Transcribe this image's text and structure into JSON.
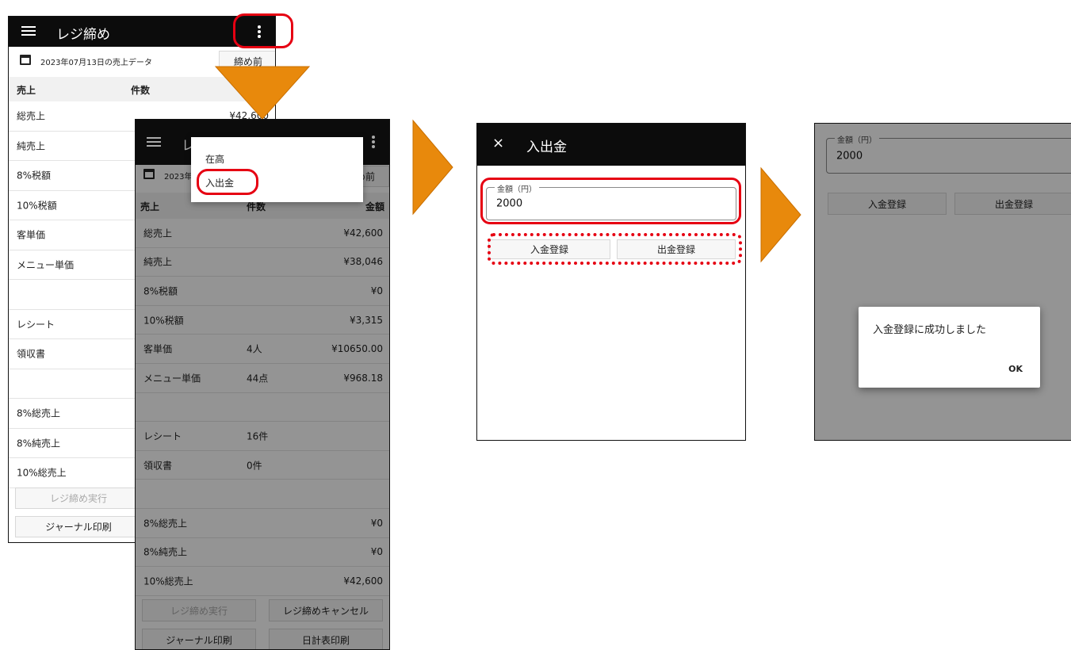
{
  "colors": {
    "appbar": "#0c0c0c",
    "highlight": "#e60012",
    "arrow": "#e8890c"
  },
  "screen1": {
    "menu_icon": "hamburger-icon",
    "title": "レジ締め",
    "overflow_icon": "more-vert-icon",
    "date_text": "2023年07月13日の売上データ",
    "status_button": "締め前",
    "header": {
      "col1": "売上",
      "col2": "件数"
    },
    "rows": [
      {
        "label": "総売上",
        "count": "",
        "amount": "¥42,600"
      },
      {
        "label": "純売上",
        "count": "",
        "amount": ""
      },
      {
        "label": "8%税額",
        "count": "",
        "amount": ""
      },
      {
        "label": "10%税額",
        "count": "",
        "amount": ""
      },
      {
        "label": "客単価",
        "count": "",
        "amount": ""
      },
      {
        "label": "メニュー単価",
        "count": "",
        "amount": ""
      },
      {
        "label": "",
        "count": "",
        "amount": ""
      },
      {
        "label": "レシート",
        "count": "",
        "amount": ""
      },
      {
        "label": "領収書",
        "count": "",
        "amount": ""
      },
      {
        "label": "",
        "count": "",
        "amount": ""
      },
      {
        "label": "8%総売上",
        "count": "",
        "amount": ""
      },
      {
        "label": "8%純売上",
        "count": "",
        "amount": ""
      },
      {
        "label": "10%総売上",
        "count": "",
        "amount": ""
      }
    ],
    "execute_button": "レジ締め実行",
    "journal_button": "ジャーナル印刷"
  },
  "screen2": {
    "title": "レジ締め",
    "date_text": "2023年",
    "status_button": "締め前",
    "header": {
      "col1": "売上",
      "col2": "件数",
      "col3": "金額"
    },
    "rows": [
      {
        "label": "総売上",
        "count": "",
        "amount": "¥42,600"
      },
      {
        "label": "純売上",
        "count": "",
        "amount": "¥38,046"
      },
      {
        "label": "8%税額",
        "count": "",
        "amount": "¥0"
      },
      {
        "label": "10%税額",
        "count": "",
        "amount": "¥3,315"
      },
      {
        "label": "客単価",
        "count": "4人",
        "amount": "¥10650.00"
      },
      {
        "label": "メニュー単価",
        "count": "44点",
        "amount": "¥968.18"
      },
      {
        "label": "",
        "count": "",
        "amount": ""
      },
      {
        "label": "レシート",
        "count": "16件",
        "amount": ""
      },
      {
        "label": "領収書",
        "count": "0件",
        "amount": ""
      },
      {
        "label": "",
        "count": "",
        "amount": ""
      },
      {
        "label": "8%総売上",
        "count": "",
        "amount": "¥0"
      },
      {
        "label": "8%純売上",
        "count": "",
        "amount": "¥0"
      },
      {
        "label": "10%総売上",
        "count": "",
        "amount": "¥42,600"
      }
    ],
    "execute_button": "レジ締め実行",
    "cancel_button": "レジ締めキャンセル",
    "journal_button": "ジャーナル印刷",
    "daily_button": "日計表印刷",
    "menu": {
      "item1": "在高",
      "item2": "入出金"
    }
  },
  "screen3": {
    "close_icon": "close-icon",
    "title": "入出金",
    "field_label": "金額（円）",
    "field_value": "2000",
    "deposit_button": "入金登録",
    "withdraw_button": "出金登録"
  },
  "screen4": {
    "field_label": "金額（円）",
    "field_value": "2000",
    "deposit_button": "入金登録",
    "withdraw_button": "出金登録",
    "dialog_message": "入金登録に成功しました",
    "ok_button": "OK"
  }
}
